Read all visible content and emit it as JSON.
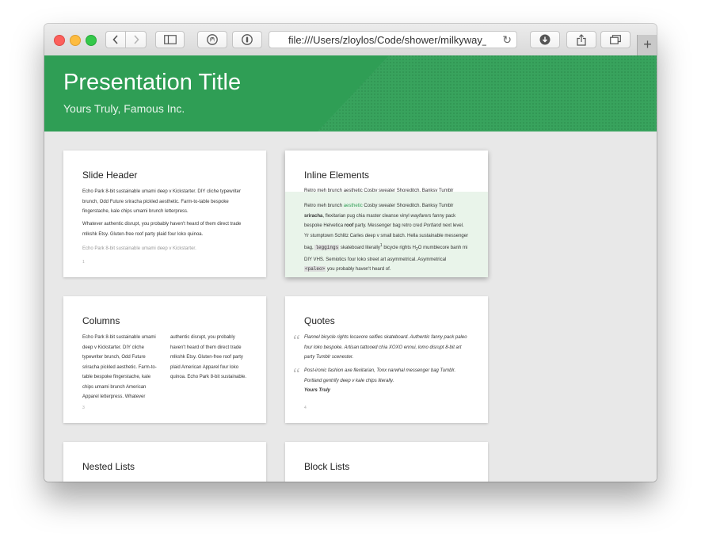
{
  "browser": {
    "url": "file:///Users/zloylos/Code/shower/milkyway_ma",
    "new_tab": "+"
  },
  "header": {
    "title": "Presentation Title",
    "subtitle": "Yours Truly, Famous Inc."
  },
  "slides": [
    {
      "title": "Slide Header",
      "p1": "Echo Park 8-bit sustainable umami deep v Kickstarter. DIY cliche typewriter brunch, Odd Future sriracha pickled aesthetic. Farm-to-table bespoke fingerstache, kale chips umami brunch letterpress.",
      "p2": "Whatever authentic disrupt, you probably haven't heard of them direct trade mlkshk Etsy. Gluten-free roof party plaid four loko quinoa.",
      "note": "Echo Park 8-bit sustainable umami deep v Kickstarter.",
      "num": "1"
    },
    {
      "title": "Inline Elements",
      "peek": "Retro meh brunch aesthetic Cosby sweater Shoreditch. Banksy Tumblr",
      "body": {
        "a1": "Retro meh brunch ",
        "a2": "aesthetic",
        "a3": " Cosby sweater Shoreditch. Banksy Tumblr ",
        "b1": "sriracha",
        "b2": ", flexitarian pug chia master cleanse vinyl ",
        "b3": "wayfarers",
        "b4": " fanny pack bespoke Helvetica ",
        "b5": "roof",
        "b6": " party. Messenger bag retro cred ",
        "b7": "Portland",
        "b8": " next level. Yr stumptown Schlitz Carles deep v small batch. Hella sustainable messenger bag, ",
        "c1": "leggings",
        "c2": " skateboard literally",
        "c3": "1",
        "c4": " bicycle rights H",
        "c5": "2",
        "c6": "O mumblecore banh mi DIY VHS. Semiotics four loko street art asymmetrical. Asymmetrical ",
        "c7": "<paleo>",
        "c8": " you probably haven't heard of."
      }
    },
    {
      "title": "Columns",
      "col1": "Echo Park 8-bit sustainable umami deep v Kickstarter. DIY cliche typewriter brunch, Odd Future sriracha pickled aesthetic. Farm-to-table bespoke fingerstache, kale chips umami brunch American Apparel letterpress. Whatever",
      "col2": "authentic disrupt, you probably haven't heard of them direct trade mlkshk Etsy. Gluten-free roof party plaid American Apparel four loko quinoa. Echo Park 8-bit sustainable.",
      "num": "3"
    },
    {
      "title": "Quotes",
      "q1": "Flannel bicycle rights locavore selfies skateboard. Authentic fanny pack paleo four loko bespoke. Artisan tattooed chia XOXO ennui, lomo disrupt 8-bit art party Tumblr scenester.",
      "q2": "Post-ironic fashion axe flexitarian, Tonx narwhal messenger bag Tumblr. Portland gentrify deep v kale chips literally.",
      "author": "Yours Truly",
      "num": "4"
    },
    {
      "title": "Nested Lists"
    },
    {
      "title": "Block Lists"
    }
  ],
  "icons": {
    "back": "chevron-left-icon",
    "forward": "chevron-right-icon",
    "sidebar": "sidebar-icon",
    "shield": "privacy-icon",
    "password": "password-icon",
    "download": "download-icon",
    "share": "share-icon",
    "tabs": "tabs-icon",
    "reload": "reload-icon"
  },
  "colors": {
    "header_green": "#2f9e55",
    "highlight_bg": "#e9f4ea"
  }
}
